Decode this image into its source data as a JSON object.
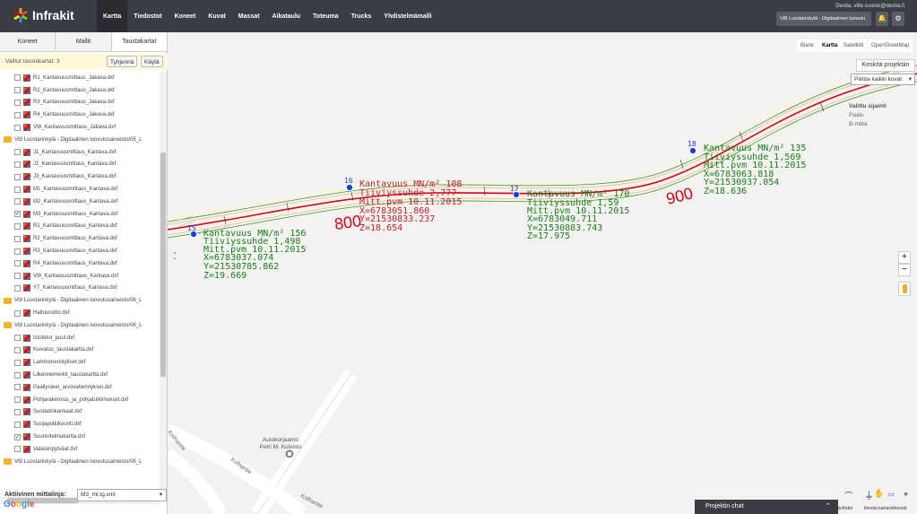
{
  "brand": {
    "name": "Infrakit"
  },
  "nav": [
    "Kartta",
    "Tiedostot",
    "Koneet",
    "Kuvat",
    "Massat",
    "Aikataulu",
    "Toteuma",
    "Trucks",
    "Yhdistelmämalli"
  ],
  "user": {
    "email": "Destia, ville.suonio@destia.fi",
    "project": "Vt8 Luostarinkylä - Digitaalinen luovutu"
  },
  "sidebar": {
    "tabs": [
      "Koneet",
      "Mallit",
      "Taustakartat"
    ],
    "selected_label": "Valitut taustakartat: 3",
    "clear_label": "Tyhjennä",
    "use_label": "Käytä",
    "rows": [
      {
        "type": "file",
        "checked": false,
        "text": "R1_Kantavuusmittaus_Jakava.dxf"
      },
      {
        "type": "file",
        "checked": false,
        "text": "R2_Kantavuusmittaus_Jakava.dxf"
      },
      {
        "type": "file",
        "checked": false,
        "text": "R3_Kantavuusmittaus_Jakava.dxf"
      },
      {
        "type": "file",
        "checked": false,
        "text": "R4_Kantavuusmittaus_Jakava.dxf"
      },
      {
        "type": "file",
        "checked": false,
        "text": "Vt8_Kantavuusmittaus_Jakava.dxf"
      },
      {
        "type": "folder",
        "checked": false,
        "text": "Vt8 Luostarinkylä - Digitaalinen luovutusaineisto/05_L"
      },
      {
        "type": "file",
        "checked": false,
        "text": "J1_Kantavuusmittaus_Kantava.dxf"
      },
      {
        "type": "file",
        "checked": false,
        "text": "J2_Kantavuusmittaus_Kantava.dxf"
      },
      {
        "type": "file",
        "checked": false,
        "text": "J3_Kantavuusmittaus_Kantava.dxf"
      },
      {
        "type": "file",
        "checked": false,
        "text": "M1_Kantavuusmittaus_Kantava.dxf"
      },
      {
        "type": "file",
        "checked": false,
        "text": "M2_Kantavuusmittaus_Kantava.dxf"
      },
      {
        "type": "file",
        "checked": true,
        "text": "M3_Kantavuusmittaus_Kantava.dxf"
      },
      {
        "type": "file",
        "checked": false,
        "text": "R1_Kantavuusmittaus_Kantava.dxf"
      },
      {
        "type": "file",
        "checked": false,
        "text": "R2_Kantavuusmittaus_Kantava.dxf"
      },
      {
        "type": "file",
        "checked": false,
        "text": "R3_Kantavuusmittaus_Kantava.dxf"
      },
      {
        "type": "file",
        "checked": false,
        "text": "R4_Kantavuusmittaus_Kantava.dxf"
      },
      {
        "type": "file",
        "checked": false,
        "text": "Vt8_Kantavuusmittaus_Kantava.dxf"
      },
      {
        "type": "file",
        "checked": false,
        "text": "Y7_Kantavuusmittaus_Kantava.dxf"
      },
      {
        "type": "folder",
        "checked": false,
        "text": "Vt8 Luostarinkylä - Digitaalinen luovutusaineisto/06_L"
      },
      {
        "type": "file",
        "checked": false,
        "text": "Haltuunotto.dxf"
      },
      {
        "type": "folder",
        "checked": false,
        "text": "Vt8 Luostarinkylä - Digitaalinen luovutusaineisto/06_L"
      },
      {
        "type": "file",
        "checked": false,
        "text": "Istutetut_puut.dxf"
      },
      {
        "type": "file",
        "checked": false,
        "text": "Kuivatus_taustakartta.dxf"
      },
      {
        "type": "file",
        "checked": false,
        "text": "Lammoneristykset.dxf"
      },
      {
        "type": "file",
        "checked": false,
        "text": "Liikennemerkit_taustakartta.dxf"
      },
      {
        "type": "file",
        "checked": false,
        "text": "Paallysteet_arvovahennykset.dxf"
      },
      {
        "type": "file",
        "checked": false,
        "text": "Pohjarakennus_ja_pohjatutkimukset.dxf"
      },
      {
        "type": "file",
        "checked": false,
        "text": "Suodatinkankaat.dxf"
      },
      {
        "type": "file",
        "checked": false,
        "text": "Suojaputkikoonti.dxf"
      },
      {
        "type": "file",
        "checked": true,
        "text": "Suunnitelmakartta.dxf"
      },
      {
        "type": "file",
        "checked": false,
        "text": "Valaisinpylväat.dxf"
      },
      {
        "type": "folder",
        "checked": false,
        "text": "Vt8 Luostarinkylä - Digitaalinen luovutusaineisto/06_L"
      }
    ],
    "active_line_label": "Aktiivinen mittalinja:",
    "active_line_value": "M3_ml.tg.xml"
  },
  "map": {
    "types": [
      "Blank",
      "Kartta",
      "Satelliitti",
      "OpenStreetMap"
    ],
    "active_type": "Kartta",
    "center_label": "Keskitä projektiin",
    "hide_images_label": "Piilota kaikki kuvat",
    "selected_title": "Valittu sijainti",
    "selected_lines": [
      "Paalu",
      "B-mitta"
    ],
    "station_labels": [
      "800",
      "900"
    ],
    "points": [
      {
        "id": "15",
        "lines": [
          "Kantavuus MN/m² 156",
          "Tiiviyssuhde 1,498",
          "Mitt.pvm 10.11.2015",
          "X=6783037.074",
          "Y=21530785.862",
          "Z=19.669"
        ]
      },
      {
        "id": "16",
        "lines": [
          "Kantavuus MN/m² 108",
          "Tiiviyssuhde 2,777",
          "Mitt.pvm 10.11.2015",
          "X=6783051.860",
          "Y=21530833.237",
          "Z=18.654"
        ]
      },
      {
        "id": "17",
        "lines": [
          "Kantavuus MN/m² 170",
          "Tiiviyssuhde 1,59",
          "Mitt.pvm 10.11.2015",
          "X=6783049.711",
          "Y=21530883.743",
          "Z=17.975"
        ]
      },
      {
        "id": "18",
        "lines": [
          "Kantavuus MN/m² 135",
          "Tiiviyssuhde 1,569",
          "Mitt.pvm 10.11.2015",
          "X=6783063.818",
          "Y=21530937.054",
          "Z=18.636"
        ]
      }
    ],
    "poi": [
      "Autokorjaamo",
      "Petri M. Koivisto"
    ],
    "streets": [
      "Kolhantie",
      "Kolhantie",
      "Kolhantie"
    ],
    "zoom_in": "+",
    "zoom_out": "−",
    "chat_label": "Projektin chat",
    "tool_labels": [
      "ytyöhdot",
      "Ilmoita kartavirheestä"
    ],
    "google": "Google"
  },
  "colors": {
    "topbar": "#3a3d44",
    "road_red": "#d0021b",
    "road_green": "#2e9e2e",
    "point_blue": "#1a3fdc"
  }
}
